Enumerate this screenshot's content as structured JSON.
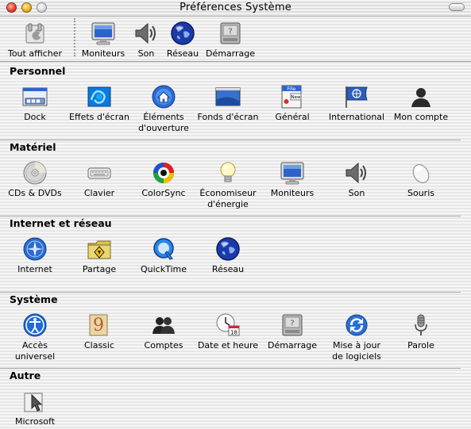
{
  "window": {
    "title": "Préférences Système"
  },
  "toolbar": {
    "show_all": {
      "label": "Tout afficher",
      "icon": "apple-switch-icon"
    },
    "items": [
      {
        "label": "Moniteurs",
        "icon": "monitor-icon"
      },
      {
        "label": "Son",
        "icon": "speaker-icon"
      },
      {
        "label": "Réseau",
        "icon": "globe-icon"
      },
      {
        "label": "Démarrage",
        "icon": "startup-disk-icon"
      }
    ]
  },
  "sections": [
    {
      "title": "Personnel",
      "items": [
        {
          "label": "Dock",
          "icon": "dock-icon"
        },
        {
          "label": "Effets d'écran",
          "icon": "screen-effects-icon"
        },
        {
          "label": "Éléments\nd'ouverture",
          "icon": "login-items-icon"
        },
        {
          "label": "Fonds d'écran",
          "icon": "desktop-icon"
        },
        {
          "label": "Général",
          "icon": "general-icon"
        },
        {
          "label": "International",
          "icon": "international-flag-icon"
        },
        {
          "label": "Mon compte",
          "icon": "my-account-icon"
        }
      ]
    },
    {
      "title": "Matériel",
      "items": [
        {
          "label": "CDs & DVDs",
          "icon": "cd-icon"
        },
        {
          "label": "Clavier",
          "icon": "keyboard-icon"
        },
        {
          "label": "ColorSync",
          "icon": "colorsync-icon"
        },
        {
          "label": "Économiseur\nd'énergie",
          "icon": "lightbulb-icon"
        },
        {
          "label": "Moniteurs",
          "icon": "monitor-icon"
        },
        {
          "label": "Son",
          "icon": "speaker-icon"
        },
        {
          "label": "Souris",
          "icon": "mouse-icon"
        }
      ]
    },
    {
      "title": "Internet et réseau",
      "items": [
        {
          "label": "Internet",
          "icon": "internet-icon"
        },
        {
          "label": "Partage",
          "icon": "sharing-folder-icon"
        },
        {
          "label": "QuickTime",
          "icon": "quicktime-icon"
        },
        {
          "label": "Réseau",
          "icon": "globe-icon"
        }
      ]
    },
    {
      "title": "Système",
      "items": [
        {
          "label": "Accès\nuniversel",
          "icon": "universal-access-icon"
        },
        {
          "label": "Classic",
          "icon": "classic-icon"
        },
        {
          "label": "Comptes",
          "icon": "accounts-icon"
        },
        {
          "label": "Date et heure",
          "icon": "date-time-icon"
        },
        {
          "label": "Démarrage",
          "icon": "startup-disk-icon"
        },
        {
          "label": "Mise à jour\nde logiciels",
          "icon": "software-update-icon"
        },
        {
          "label": "Parole",
          "icon": "microphone-icon"
        }
      ]
    },
    {
      "title": "Autre",
      "items": [
        {
          "label": "Microsoft Mouse",
          "icon": "microsoft-mouse-icon"
        }
      ]
    }
  ]
}
